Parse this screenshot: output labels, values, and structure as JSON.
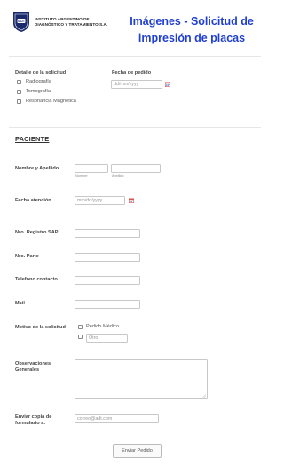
{
  "header": {
    "logo_line1": "INSTITUTO ARGENTINO DE",
    "logo_line2": "DIAGNÓSTICO Y TRATAMIENTO S.A.",
    "title_line1": "Imágenes - Solicitud de",
    "title_line2": "impresión de placas"
  },
  "request": {
    "detail_label": "Detalle de la solicitud",
    "options": [
      "Radiografía",
      "Tomografía",
      "Resonancia Magnética"
    ],
    "date_label": "Fecha de pedido",
    "date_placeholder": "dd/mm/yyyy"
  },
  "section": {
    "title": "PACIENTE"
  },
  "patient": {
    "name_label": "Nombre y Apellido",
    "first_sublabel": "Nombre",
    "last_sublabel": "Apellido",
    "attention_label": "Fecha atención",
    "attention_placeholder": "mm/dd/yyyy",
    "sap_label": "Nro. Registro SAP",
    "part_label": "Nro. Parte",
    "phone_label": "Telefono contacto",
    "mail_label": "Mail",
    "reason_label": "Motivo de la solicitud",
    "reason_option": "Pedido Médico",
    "other_placeholder": "Otro",
    "observations_label_line1": "Observaciones",
    "observations_label_line2": "Generales",
    "copy_label_line1": "Enviar copia de",
    "copy_label_line2": "formulario a:",
    "copy_placeholder": "correo@adt.com"
  },
  "submit": {
    "label": "Enviar Pedido"
  },
  "colors": {
    "title": "#1f3fd1",
    "logo_navy": "#1b2a6b",
    "calendar": "#d9534f"
  }
}
